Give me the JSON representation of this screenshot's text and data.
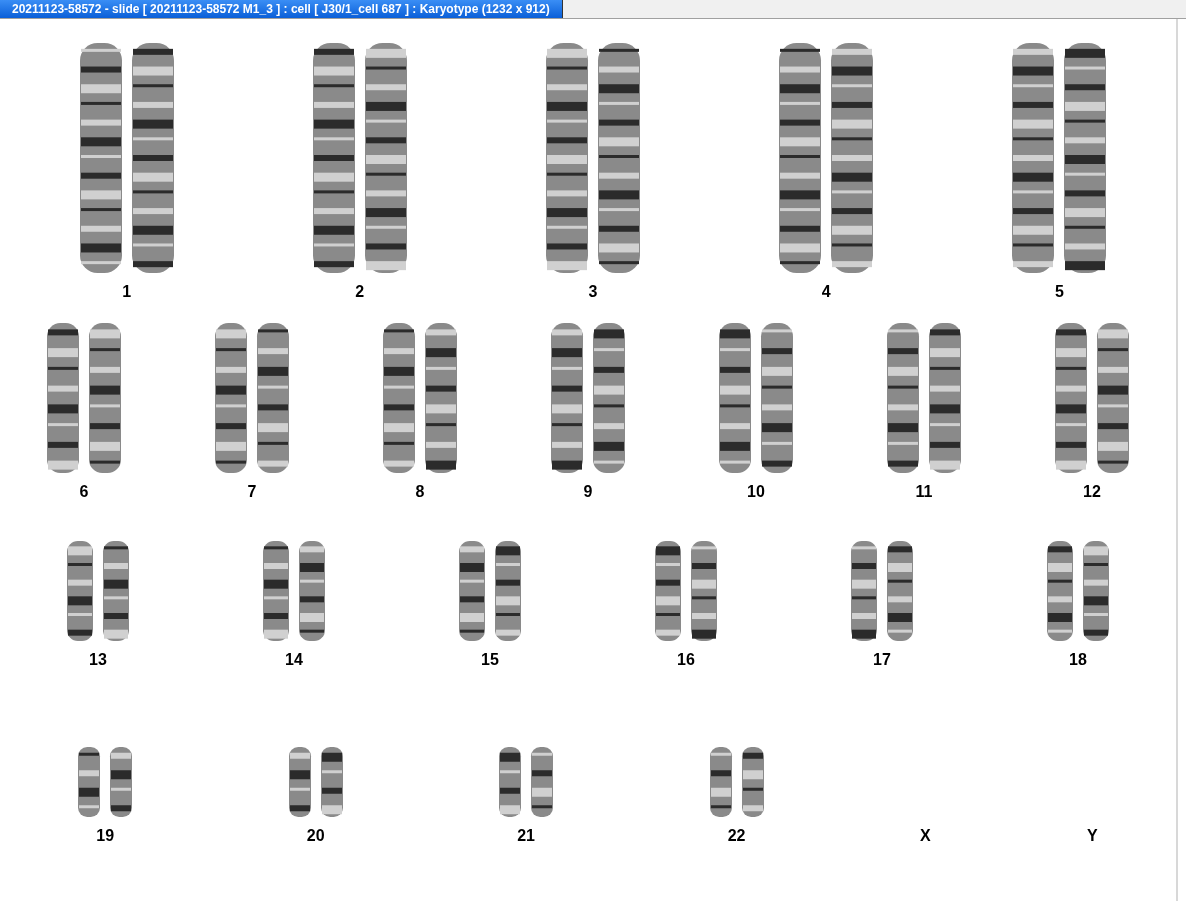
{
  "window": {
    "title": "20211123-58572 - slide [ 20211123-58572 M1_3 ] : cell [ J30/1_cell 687 ] : Karyotype  (1232 x 912)"
  },
  "karyotype": {
    "rows": [
      {
        "groups": [
          {
            "label": "1",
            "kind": "pair"
          },
          {
            "label": "2",
            "kind": "pair"
          },
          {
            "label": "3",
            "kind": "pair"
          },
          {
            "label": "4",
            "kind": "pair"
          },
          {
            "label": "5",
            "kind": "pair"
          }
        ]
      },
      {
        "groups": [
          {
            "label": "6",
            "kind": "pair"
          },
          {
            "label": "7",
            "kind": "pair"
          },
          {
            "label": "8",
            "kind": "pair"
          },
          {
            "label": "9",
            "kind": "pair"
          },
          {
            "label": "10",
            "kind": "pair"
          },
          {
            "label": "11",
            "kind": "pair"
          },
          {
            "label": "12",
            "kind": "pair"
          }
        ]
      },
      {
        "groups": [
          {
            "label": "13",
            "kind": "pair"
          },
          {
            "label": "14",
            "kind": "pair"
          },
          {
            "label": "15",
            "kind": "pair"
          },
          {
            "label": "16",
            "kind": "pair"
          },
          {
            "label": "17",
            "kind": "pair"
          },
          {
            "label": "18",
            "kind": "pair"
          }
        ]
      },
      {
        "groups": [
          {
            "label": "19",
            "kind": "pair"
          },
          {
            "label": "20",
            "kind": "pair"
          },
          {
            "label": "21",
            "kind": "pair"
          },
          {
            "label": "22",
            "kind": "pair"
          },
          {
            "label": "X",
            "kind": "empty"
          },
          {
            "label": "Y",
            "kind": "empty"
          }
        ]
      }
    ]
  }
}
